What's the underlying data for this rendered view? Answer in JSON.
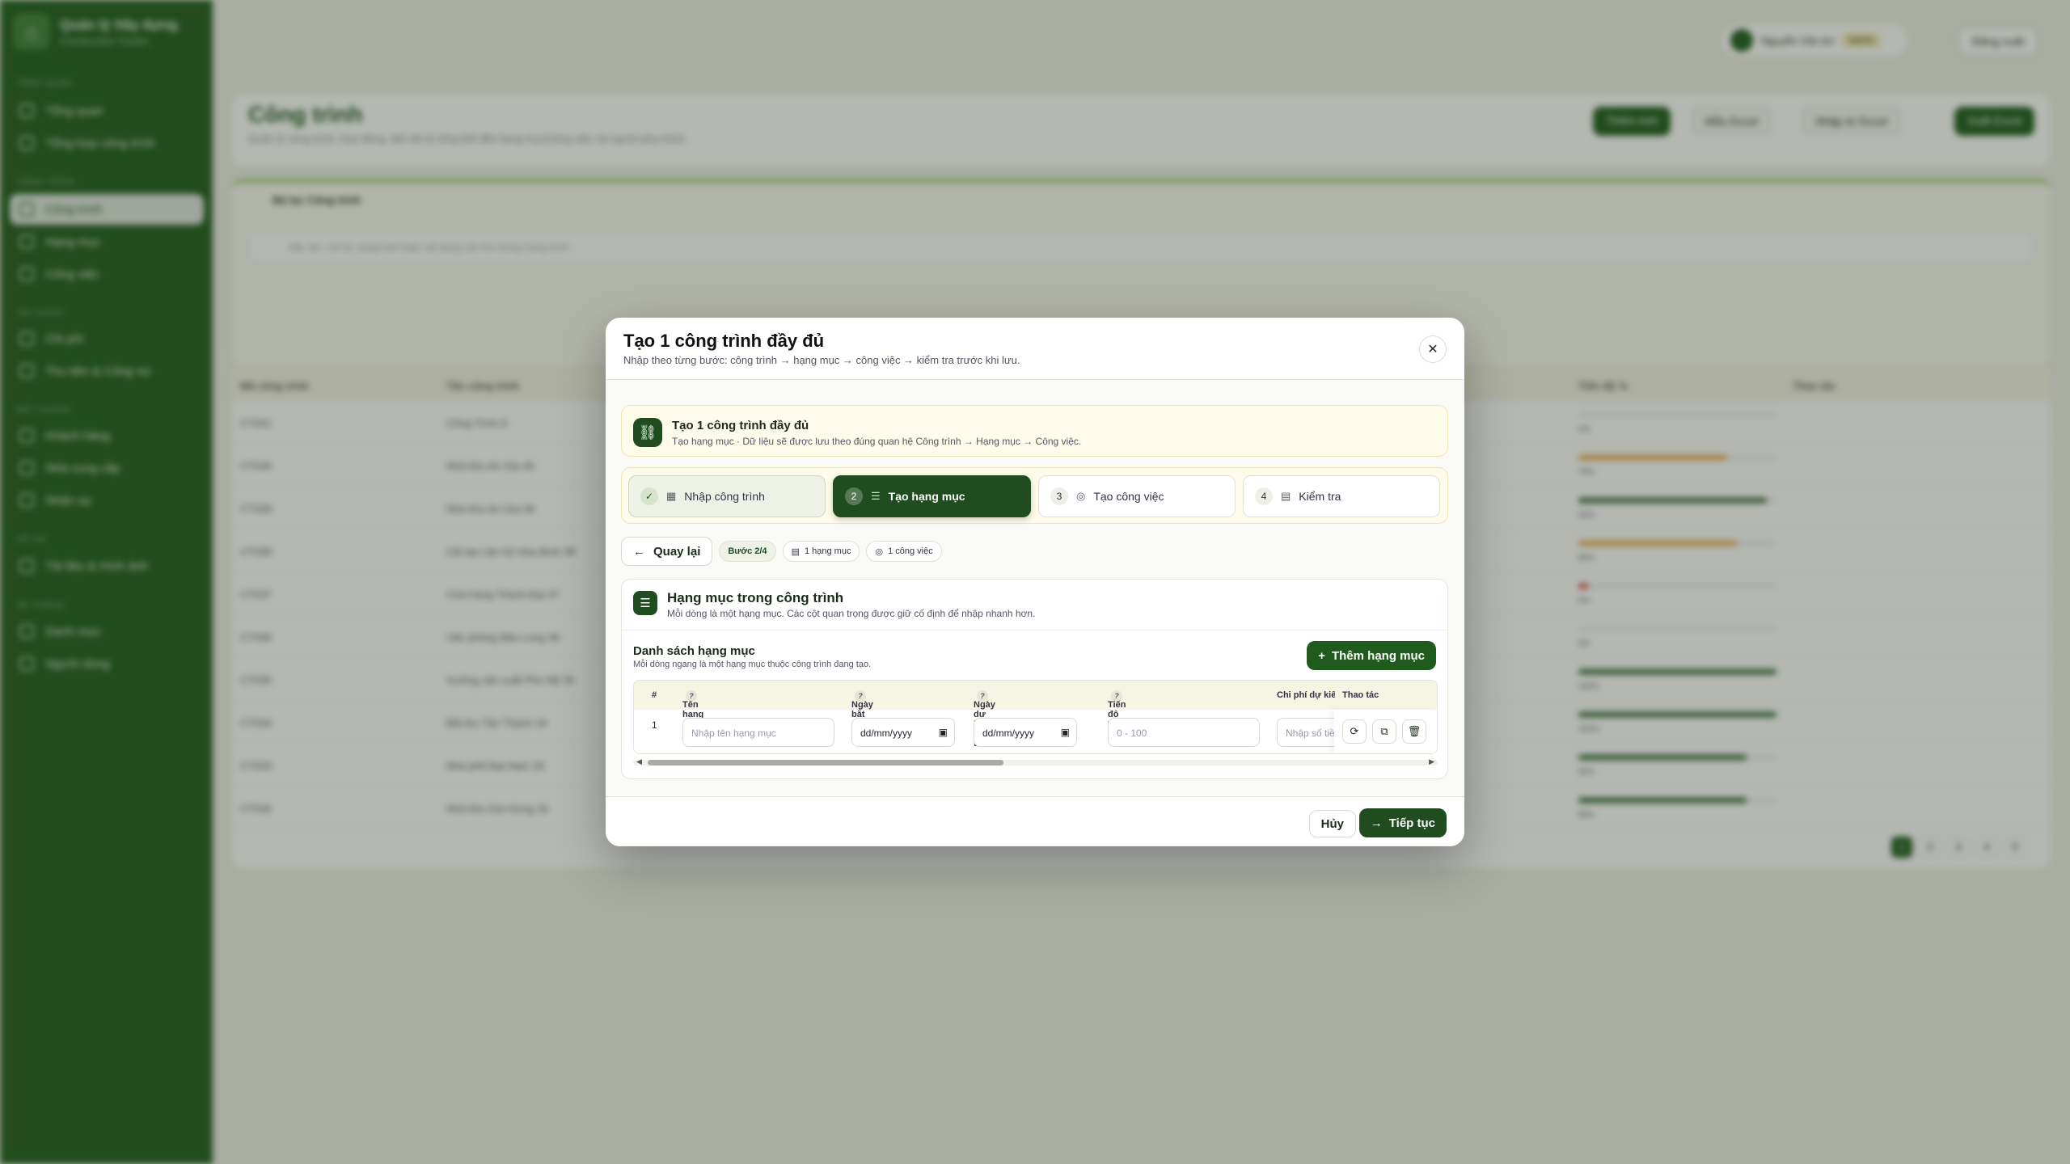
{
  "app": {
    "name": "Quản lý Xây dựng",
    "subtitle": "Construction Tracker"
  },
  "sidebar": {
    "sections": [
      "Tổng quan",
      "Công trình",
      "Tài chính",
      "Đối tượng",
      "Hồ sơ",
      "Hệ thống"
    ],
    "items": [
      "Tổng quan",
      "Tổng hợp công trình",
      "Công trình",
      "Hạng mục",
      "Công việc",
      "Chi phí",
      "Thu tiền & Công nợ",
      "Khách hàng",
      "Nhà cung cấp",
      "Nhân sự",
      "Tài liệu & Hình ảnh",
      "Danh mục",
      "Người dùng"
    ]
  },
  "header": {
    "user": "Nguyễn Văn An",
    "role": "Admin",
    "logout": "Đăng xuất"
  },
  "page": {
    "title": "Công trình",
    "subtitle": "Quản lý công trình, hợp đồng, tiến độ từ tổng thể đến hạng mục/công việc và người phụ trách.",
    "buttons": [
      "Thêm mới",
      "Mẫu Excel",
      "Nhập từ Excel",
      "Xuất Excel"
    ]
  },
  "filter": {
    "title": "Bộ lọc Công trình",
    "search_placeholder": "Mã, tên, mô tả, trạng thái hoặc nội dung cần tìm trong Công trình..."
  },
  "table": {
    "headers": [
      "Mã công trình",
      "Tên công trình",
      "Tiến độ %",
      "Thao tác"
    ],
    "rows": [
      {
        "code": "CT041",
        "name": "Công Trình A",
        "progress": "0%"
      },
      {
        "code": "CT040",
        "name": "Nhà kho An Gia 40",
        "progress": "75%"
      },
      {
        "code": "CT039",
        "name": "Nhà kho An Gia 39",
        "progress": "95%"
      },
      {
        "code": "CT038",
        "name": "Cải tạo căn hộ Hòa Bình 38",
        "progress": "80%"
      },
      {
        "code": "CT037",
        "name": "Cửa hàng Thành Đạt 37",
        "progress": "5%"
      },
      {
        "code": "CT036",
        "name": "Văn phòng Bảo Long 36",
        "progress": "0%"
      },
      {
        "code": "CT035",
        "name": "Xưởng sản xuất Phú Mỹ 35",
        "progress": "100%"
      },
      {
        "code": "CT034",
        "name": "Bãi thu Tân Thành 34",
        "progress": "100%"
      },
      {
        "code": "CT033",
        "name": "Nhà phố Đại Nam 33",
        "progress": "85%"
      },
      {
        "code": "CT032",
        "name": "Nhà kho Gia Hưng 32",
        "progress": "85%"
      }
    ],
    "pages": [
      "1",
      "2",
      "3",
      "4",
      "5"
    ]
  },
  "colors": {
    "brand": "#1f5b1c",
    "brand_dark": "#1f4d1f",
    "info_bg": "#fffbea",
    "bar_orange": "#e8a23a",
    "bar_red": "#d9352b"
  },
  "modal": {
    "title": "Tạo 1 công trình đầy đủ",
    "subtitle": "Nhập theo từng bước: công trình → hạng mục → công việc → kiểm tra trước khi lưu.",
    "info_title": "Tạo 1 công trình đầy đủ",
    "info_sub": "Tạo hạng mục · Dữ liệu sẽ được lưu theo đúng quan hệ Công trình → Hạng mục → Công việc.",
    "steps": [
      {
        "num": "✓",
        "label": "Nhập công trình"
      },
      {
        "num": "2",
        "label": "Tạo hạng mục"
      },
      {
        "num": "3",
        "label": "Tạo công việc"
      },
      {
        "num": "4",
        "label": "Kiểm tra"
      }
    ],
    "back": "Quay lại",
    "chip_step": "Bước 2/4",
    "chip_items": "1 hạng mục",
    "chip_tasks": "1 công việc",
    "section_title": "Hạng mục trong công trình",
    "section_sub": "Mỗi dòng là một hạng mục. Các cột quan trọng được giữ cố định để nhập nhanh hơn.",
    "list_title": "Danh sách hạng mục",
    "list_sub": "Mỗi dòng ngang là một hạng mục thuộc công trình đang tạo.",
    "add": "Thêm hạng mục",
    "columns": [
      "#",
      "Tên hạng mục",
      "Ngày bắt đầu",
      "Ngày dự kiến hoàn thành",
      "Tiến độ %",
      "Chi phí dự kiến",
      "Thao tác"
    ],
    "row": {
      "index": "1",
      "name_placeholder": "Nhập tên hạng mục",
      "start": "dd/mm/yyyy",
      "end": "dd/mm/yyyy",
      "progress_placeholder": "0 - 100",
      "cost_placeholder": "Nhập số tiền"
    },
    "cancel": "Hủy",
    "next": "Tiếp tục"
  }
}
